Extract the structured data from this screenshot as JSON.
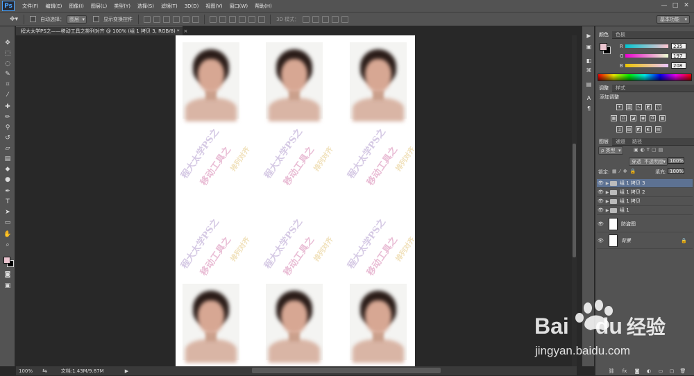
{
  "app": {
    "logo": "Ps"
  },
  "menubar": {
    "items": [
      "文件(F)",
      "编辑(E)",
      "图像(I)",
      "图层(L)",
      "类型(Y)",
      "选择(S)",
      "滤镜(T)",
      "3D(D)",
      "视图(V)",
      "窗口(W)",
      "帮助(H)"
    ],
    "window_controls": [
      "—",
      "□",
      "✕"
    ]
  },
  "options": {
    "auto_select_label": "自动选择：",
    "auto_select_value": "图层",
    "show_transform_label": "显示变换控件",
    "mode3d_label": "3D 模式：",
    "workspace": "基本功能"
  },
  "document": {
    "tab_title": "程大太学PS之——移动工具之排列对齐 @ 100% (组 1 拷贝 3, RGB/8) *",
    "tab_close": "×",
    "watermark_lines": [
      "程大太学PS之",
      "移动工具之",
      "排列对齐"
    ]
  },
  "status": {
    "zoom": "100%",
    "doc_info": "文档:1.43M/9.87M",
    "arrow": "▶"
  },
  "color_panel": {
    "tabs": [
      "颜色",
      "色板"
    ],
    "r_label": "R",
    "g_label": "G",
    "b_label": "B",
    "r": "235",
    "g": "197",
    "b": "208",
    "fg_color": "#ebc5d0"
  },
  "adjust_panel": {
    "tabs": [
      "调整",
      "样式"
    ],
    "title": "添加调整"
  },
  "layers_panel": {
    "tabs": [
      "图层",
      "通道",
      "路径"
    ],
    "filter_label": "ρ 类型",
    "blend_mode": "穿透",
    "opacity_label": "不透明度:",
    "opacity": "100%",
    "lock_label": "锁定:",
    "fill_label": "填充:",
    "fill": "100%",
    "layers": [
      {
        "name": "组 1 拷贝 3",
        "type": "group",
        "selected": true
      },
      {
        "name": "组 1 拷贝 2",
        "type": "group",
        "selected": false
      },
      {
        "name": "组 1 拷贝",
        "type": "group",
        "selected": false
      },
      {
        "name": "组 1",
        "type": "group",
        "selected": false
      },
      {
        "name": "防盗图",
        "type": "layer",
        "selected": false
      },
      {
        "name": "背景",
        "type": "background",
        "selected": false
      }
    ],
    "bottom_icons": [
      "link-icon",
      "fx-icon",
      "mask-icon",
      "adjustment-icon",
      "folder-icon",
      "new-layer-icon",
      "trash-icon"
    ]
  },
  "baidu": {
    "brand_bai": "Bai",
    "brand_du": "du",
    "brand_cn": "经验",
    "url": "jingyan.baidu.com"
  }
}
